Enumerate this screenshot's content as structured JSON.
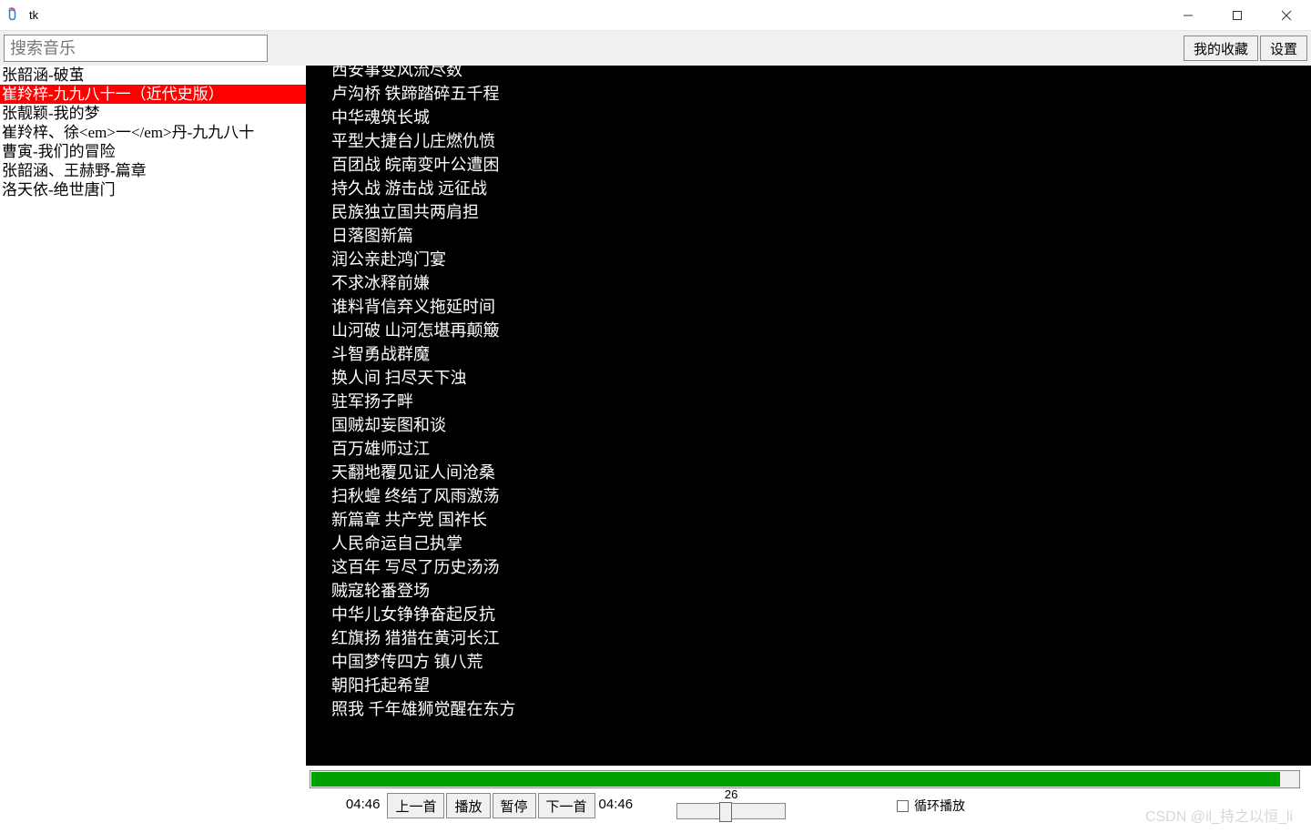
{
  "window": {
    "title": "tk"
  },
  "toolbar": {
    "search_placeholder": "搜索音乐",
    "favorites_label": "我的收藏",
    "settings_label": "设置"
  },
  "sidebar": {
    "items": [
      {
        "label": "张韶涵-破茧",
        "selected": false
      },
      {
        "label": "崔羚梓-九九八十一（近代史版）",
        "selected": true
      },
      {
        "label": "张靓颖-我的梦",
        "selected": false
      },
      {
        "label": "崔羚梓、徐<em>一</em>丹-九九八十",
        "selected": false
      },
      {
        "label": "曹寅-我们的冒险",
        "selected": false
      },
      {
        "label": "张韶涵、王赫野-篇章",
        "selected": false
      },
      {
        "label": "洛天依-绝世唐门",
        "selected": false
      }
    ]
  },
  "lyrics": [
    "西安事变风流尽数",
    "卢沟桥 铁蹄踏碎五千程",
    "中华魂筑长城",
    "平型大捷台儿庄燃仇愤",
    "百团战 皖南变叶公遭困",
    "持久战 游击战 远征战",
    "民族独立国共两肩担",
    "日落图新篇",
    "润公亲赴鸿门宴",
    "不求冰释前嫌",
    "谁料背信弃义拖延时间",
    "山河破 山河怎堪再颠簸",
    "斗智勇战群魔",
    "换人间 扫尽天下浊",
    "驻军扬子畔",
    "国贼却妄图和谈",
    "百万雄师过江",
    "天翻地覆见证人间沧桑",
    "扫秋蝗 终结了风雨激荡",
    "新篇章 共产党 国祚长",
    "人民命运自己执掌",
    "这百年 写尽了历史汤汤",
    "贼寇轮番登场",
    "中华儿女铮铮奋起反抗",
    "红旗扬 猎猎在黄河长江",
    "中国梦传四方 镇八荒",
    "朝阳托起希望",
    "照我 千年雄狮觉醒在东方"
  ],
  "player": {
    "current_time": "04:46",
    "total_time": "04:46",
    "prev_label": "上一首",
    "play_label": "播放",
    "pause_label": "暂停",
    "next_label": "下一首",
    "slider_value": "26",
    "loop_label": "循环播放",
    "progress_percent": 98
  },
  "watermark": "CSDN @il_持之以恒_li"
}
